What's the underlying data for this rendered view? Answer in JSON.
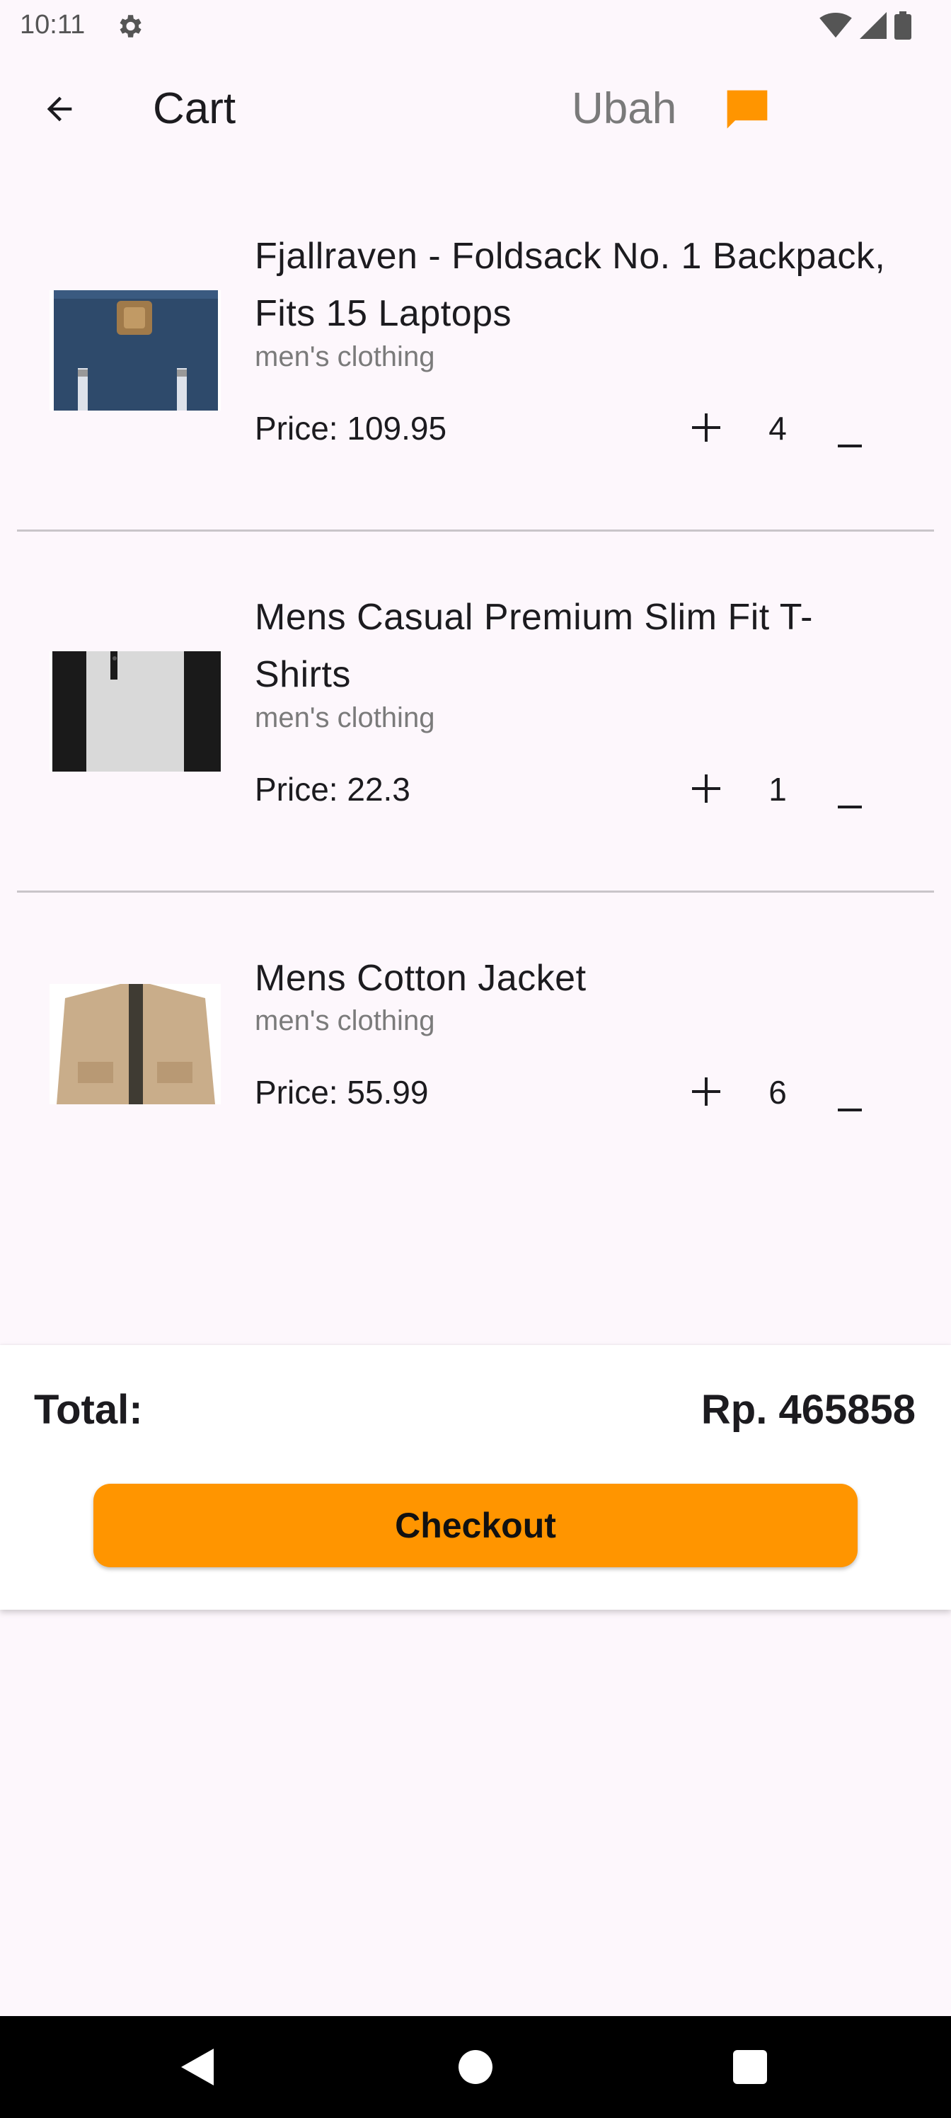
{
  "status_bar": {
    "time": "10:11",
    "icons": [
      "settings-gear-icon",
      "wifi-icon",
      "signal-icon",
      "battery-icon"
    ]
  },
  "app_bar": {
    "back_icon": "arrow-back-icon",
    "title": "Cart",
    "user_name": "Ubah",
    "chat_icon": "chat-bubble-icon",
    "accent_color": "#ff9500"
  },
  "cart": {
    "items": [
      {
        "title": "Fjallraven - Foldsack No. 1 Backpack, Fits 15 Laptops",
        "category": "men's clothing",
        "price_label": "Price: 109.95",
        "quantity": "4",
        "image": "backpack-product-image"
      },
      {
        "title": "Mens Casual Premium Slim Fit T-Shirts",
        "category": "men's clothing",
        "price_label": "Price: 22.3",
        "quantity": "1",
        "image": "tshirt-product-image"
      },
      {
        "title": "Mens Cotton Jacket",
        "category": "men's clothing",
        "price_label": "Price: 55.99",
        "quantity": "6",
        "image": "jacket-product-image"
      }
    ]
  },
  "summary": {
    "total_label": "Total:",
    "total_value": "Rp. 465858",
    "checkout_label": "Checkout"
  },
  "nav_bar": {
    "icons": [
      "nav-back-icon",
      "nav-home-icon",
      "nav-recents-icon"
    ]
  }
}
